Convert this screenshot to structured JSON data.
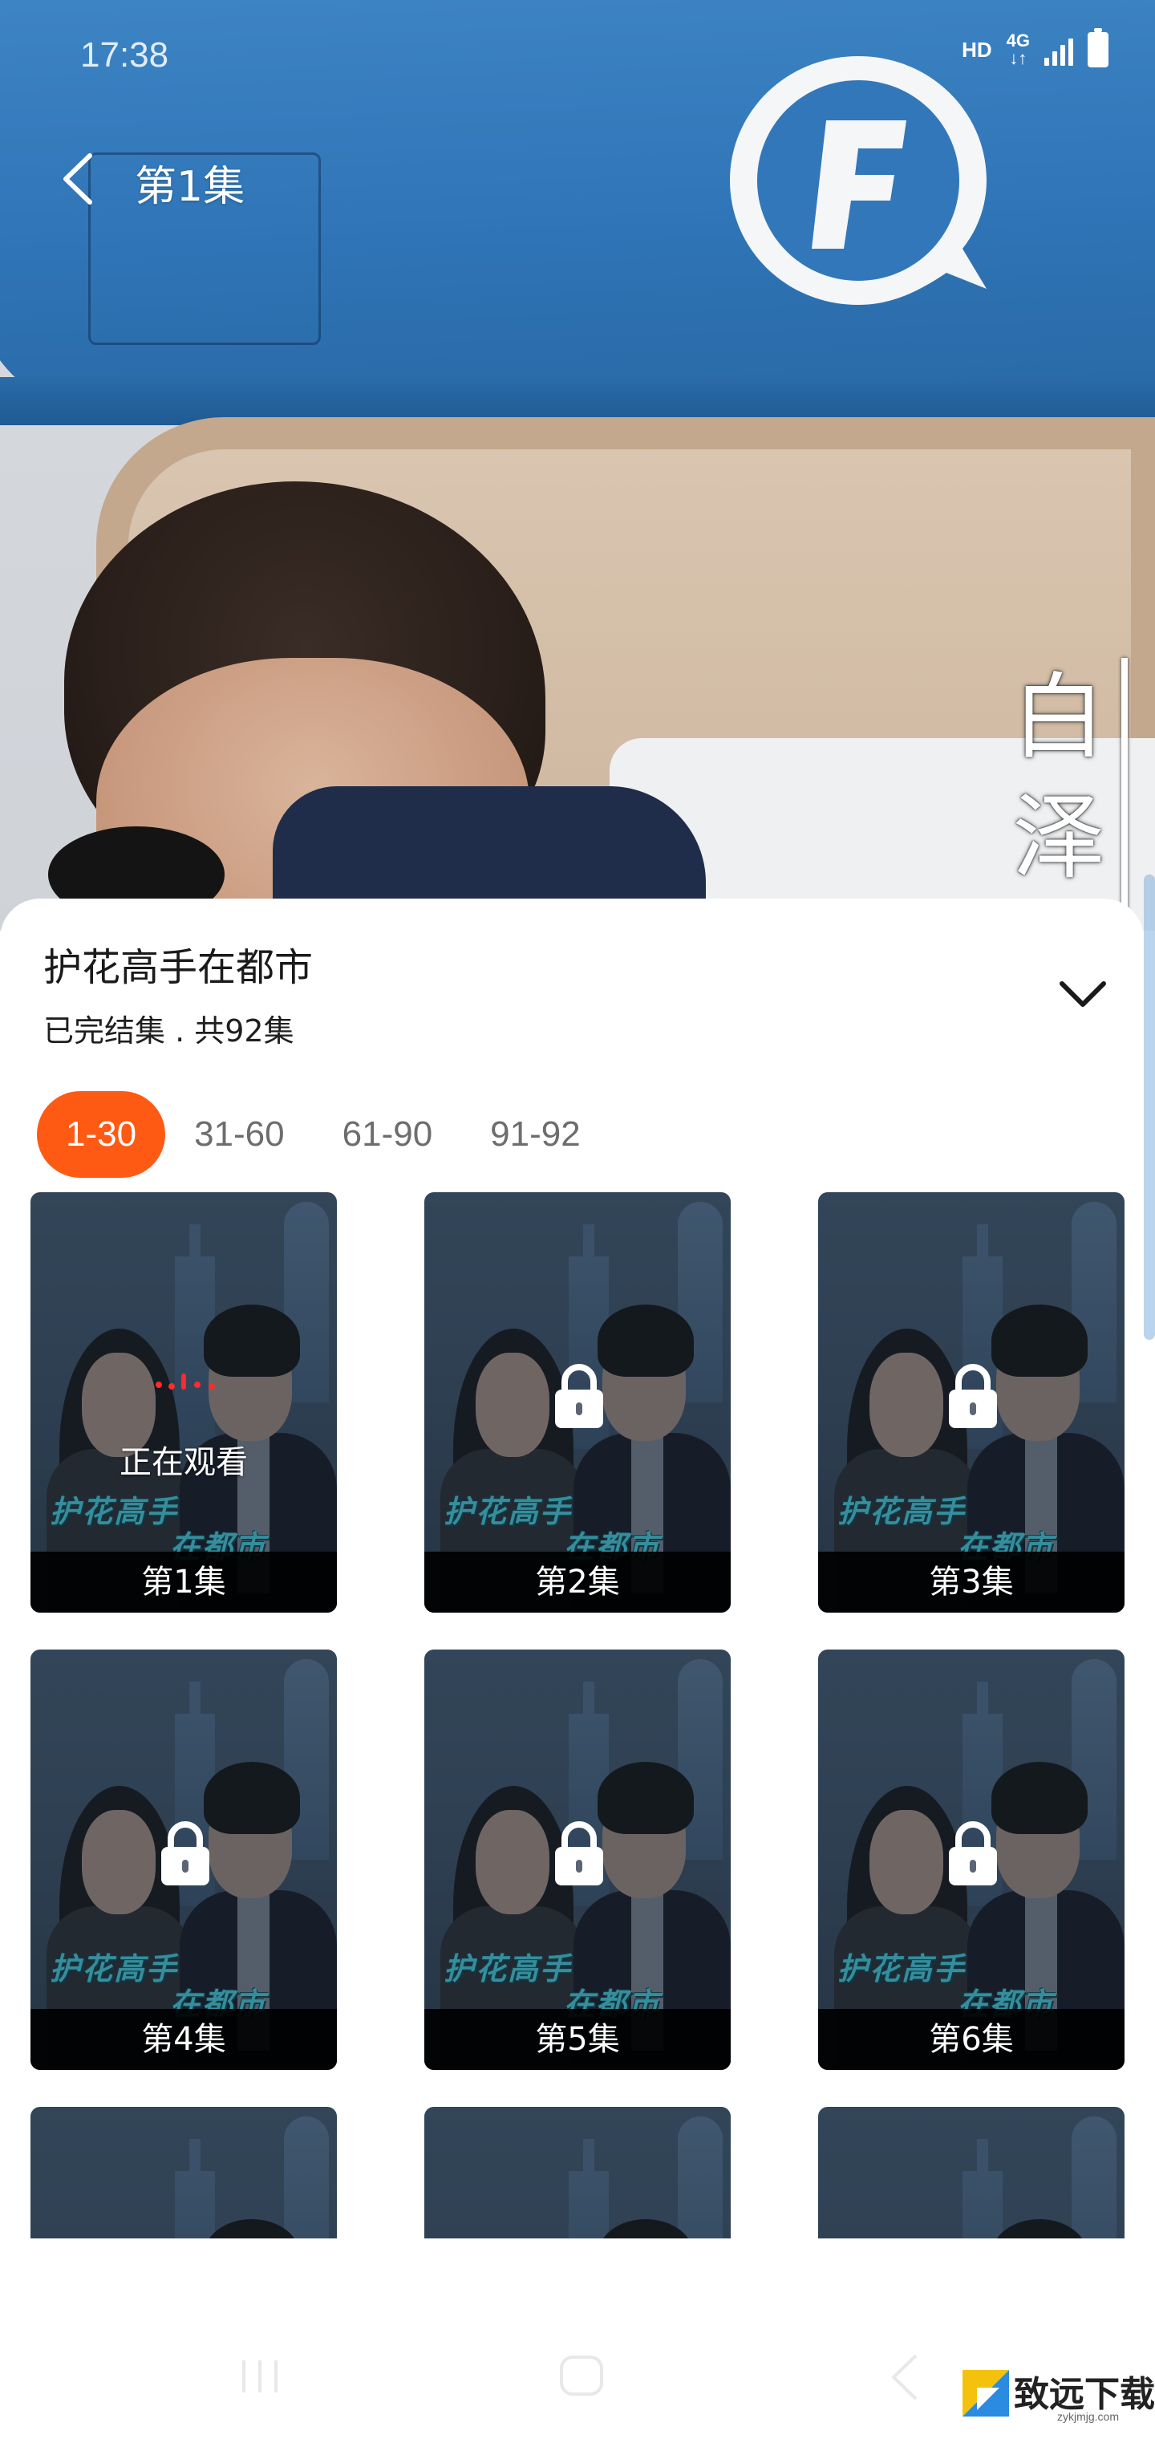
{
  "status_bar": {
    "time": "17:38",
    "hd": "HD",
    "network": "4G",
    "network_arrows": "↓↑"
  },
  "header": {
    "title": "第1集"
  },
  "video": {
    "side_text_1": "白",
    "side_text_2": "泽"
  },
  "drama": {
    "title": "护花高手在都市",
    "meta": "已完结集 . 共92集"
  },
  "tabs": [
    {
      "label": "1-30",
      "active": true
    },
    {
      "label": "31-60",
      "active": false
    },
    {
      "label": "61-90",
      "active": false
    },
    {
      "label": "91-92",
      "active": false
    }
  ],
  "cover_art": {
    "line1": "护花高手",
    "line2": "在都市"
  },
  "episodes": [
    {
      "label": "第1集",
      "state": "watching",
      "status_text": "正在观看"
    },
    {
      "label": "第2集",
      "state": "locked"
    },
    {
      "label": "第3集",
      "state": "locked"
    },
    {
      "label": "第4集",
      "state": "locked"
    },
    {
      "label": "第5集",
      "state": "locked"
    },
    {
      "label": "第6集",
      "state": "locked"
    },
    {
      "label": "",
      "state": "partial"
    },
    {
      "label": "",
      "state": "partial"
    },
    {
      "label": "",
      "state": "partial"
    }
  ],
  "watermark": {
    "text": "致远下载",
    "sub": "zykjmjg.com"
  },
  "colors": {
    "accent": "#ff5a14",
    "cover_title": "#40b4c4"
  }
}
